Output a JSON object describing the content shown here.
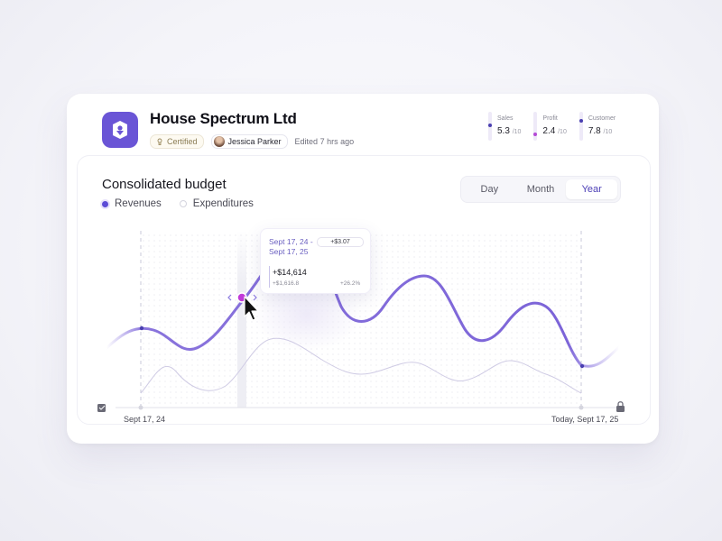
{
  "company": {
    "name": "House Spectrum Ltd",
    "certified_label": "Certified",
    "user_name": "Jessica Parker",
    "edited": "Edited 7 hrs ago"
  },
  "stats": [
    {
      "label": "Sales",
      "value": "5.3",
      "scale": "/10",
      "color": "#4a3fb0",
      "level": 0.53
    },
    {
      "label": "Profit",
      "value": "2.4",
      "scale": "/10",
      "color": "#b44ad6",
      "level": 0.24
    },
    {
      "label": "Customer",
      "value": "7.8",
      "scale": "/10",
      "color": "#4a3fb0",
      "level": 0.78
    }
  ],
  "panel": {
    "title": "Consolidated budget",
    "legend": [
      {
        "label": "Revenues",
        "color": "#5b4bd6",
        "active": true
      },
      {
        "label": "Expenditures",
        "color": "#ffffff",
        "active": false
      }
    ],
    "segments": [
      {
        "label": "Day",
        "active": false
      },
      {
        "label": "Month",
        "active": false
      },
      {
        "label": "Year",
        "active": true
      }
    ]
  },
  "tooltip": {
    "range": "Sept 17, 24 - Sept 17, 25",
    "delta": "+$3.07",
    "amount": "+$14,614",
    "sub_amount": "+$1,616.8",
    "percent": "+26.2%"
  },
  "axis": {
    "start_label": "Sept 17, 24",
    "end_label": "Today, Sept 17, 25"
  },
  "colors": {
    "accent": "#7a62d8",
    "accent_dark": "#4a3fb0",
    "highlight_dot": "#c03ad8"
  }
}
